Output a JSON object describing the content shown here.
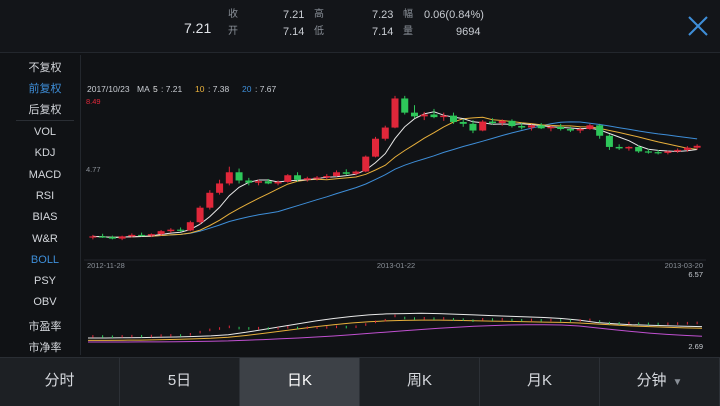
{
  "quote": {
    "price": "7.21",
    "close_label": "收",
    "close": "7.21",
    "open_label": "开",
    "open": "7.14",
    "high_label": "高",
    "high": "7.23",
    "low_label": "低",
    "low": "7.14",
    "change_label": "幅",
    "change": "0.06(0.84%)",
    "volume_label": "量",
    "volume": "9694"
  },
  "close_icon": "close-x-icon",
  "sidebar": {
    "adjust": [
      {
        "label": "不复权",
        "active": false
      },
      {
        "label": "前复权",
        "active": true
      },
      {
        "label": "后复权",
        "active": false
      }
    ],
    "indicators": [
      {
        "label": "VOL",
        "active": false
      },
      {
        "label": "KDJ",
        "active": false
      },
      {
        "label": "MACD",
        "active": false
      },
      {
        "label": "RSI",
        "active": false
      },
      {
        "label": "BIAS",
        "active": false
      },
      {
        "label": "W&R",
        "active": false
      },
      {
        "label": "BOLL",
        "active": true
      },
      {
        "label": "PSY",
        "active": false
      },
      {
        "label": "OBV",
        "active": false
      },
      {
        "label": "市盈率",
        "active": false
      },
      {
        "label": "市净率",
        "active": false
      }
    ]
  },
  "tabs": [
    {
      "label": "分时",
      "active": false
    },
    {
      "label": "5日",
      "active": false
    },
    {
      "label": "日K",
      "active": true
    },
    {
      "label": "周K",
      "active": false
    },
    {
      "label": "月K",
      "active": false
    },
    {
      "label": "分钟",
      "active": false,
      "dropdown": true
    }
  ],
  "colors": {
    "up": "#e0273a",
    "down": "#2ec75a",
    "ma5": "#e8e8e8",
    "ma10": "#e8b03c",
    "ma20": "#3e8ed8"
  },
  "chart_data": [
    {
      "type": "candlestick",
      "title": "2017/10/23",
      "ma_label": "MA",
      "legend": [
        {
          "label": "5",
          "value": "7.21",
          "color": "#e8e8e8"
        },
        {
          "label": "10",
          "value": "7.38",
          "color": "#e8b03c"
        },
        {
          "label": "20",
          "value": "7.67",
          "color": "#3e8ed8"
        }
      ],
      "ylim": [
        4.2,
        8.6
      ],
      "y_ticks": [
        "8.49",
        "4.77"
      ],
      "x_ticks": [
        "2012-11-28",
        "2013-01-22",
        "2013-03-20"
      ],
      "ohlc": [
        [
          4.75,
          4.82,
          4.7,
          4.78
        ],
        [
          4.78,
          4.85,
          4.74,
          4.76
        ],
        [
          4.76,
          4.8,
          4.7,
          4.72
        ],
        [
          4.72,
          4.8,
          4.68,
          4.78
        ],
        [
          4.78,
          4.86,
          4.75,
          4.82
        ],
        [
          4.82,
          4.88,
          4.78,
          4.8
        ],
        [
          4.8,
          4.86,
          4.76,
          4.84
        ],
        [
          4.84,
          4.95,
          4.8,
          4.92
        ],
        [
          4.92,
          5.0,
          4.88,
          4.96
        ],
        [
          4.96,
          5.02,
          4.9,
          4.94
        ],
        [
          4.94,
          5.2,
          4.92,
          5.16
        ],
        [
          5.16,
          5.6,
          5.1,
          5.55
        ],
        [
          5.55,
          6.02,
          5.5,
          5.95
        ],
        [
          5.95,
          6.3,
          5.9,
          6.2
        ],
        [
          6.2,
          6.65,
          6.15,
          6.5
        ],
        [
          6.5,
          6.6,
          6.2,
          6.28
        ],
        [
          6.28,
          6.35,
          6.15,
          6.22
        ],
        [
          6.22,
          6.3,
          6.15,
          6.26
        ],
        [
          6.26,
          6.32,
          6.18,
          6.2
        ],
        [
          6.2,
          6.28,
          6.15,
          6.24
        ],
        [
          6.24,
          6.45,
          6.22,
          6.42
        ],
        [
          6.42,
          6.5,
          6.25,
          6.3
        ],
        [
          6.3,
          6.38,
          6.25,
          6.34
        ],
        [
          6.34,
          6.4,
          6.28,
          6.36
        ],
        [
          6.36,
          6.45,
          6.32,
          6.4
        ],
        [
          6.4,
          6.55,
          6.38,
          6.5
        ],
        [
          6.5,
          6.58,
          6.42,
          6.46
        ],
        [
          6.46,
          6.55,
          6.42,
          6.52
        ],
        [
          6.52,
          6.95,
          6.5,
          6.92
        ],
        [
          6.92,
          7.45,
          6.9,
          7.4
        ],
        [
          7.4,
          7.75,
          7.35,
          7.7
        ],
        [
          7.7,
          8.55,
          7.68,
          8.48
        ],
        [
          8.48,
          8.55,
          8.05,
          8.1
        ],
        [
          8.1,
          8.3,
          7.95,
          8.0
        ],
        [
          8.0,
          8.12,
          7.9,
          8.05
        ],
        [
          8.05,
          8.2,
          7.95,
          7.98
        ],
        [
          7.98,
          8.1,
          7.88,
          8.02
        ],
        [
          8.02,
          8.1,
          7.8,
          7.85
        ],
        [
          7.85,
          7.92,
          7.72,
          7.8
        ],
        [
          7.8,
          7.9,
          7.55,
          7.62
        ],
        [
          7.62,
          7.9,
          7.6,
          7.86
        ],
        [
          7.86,
          7.95,
          7.78,
          7.82
        ],
        [
          7.82,
          7.92,
          7.75,
          7.88
        ],
        [
          7.88,
          7.92,
          7.7,
          7.74
        ],
        [
          7.74,
          7.82,
          7.65,
          7.7
        ],
        [
          7.7,
          7.78,
          7.62,
          7.76
        ],
        [
          7.76,
          7.82,
          7.66,
          7.68
        ],
        [
          7.68,
          7.75,
          7.6,
          7.72
        ],
        [
          7.72,
          7.8,
          7.62,
          7.66
        ],
        [
          7.66,
          7.72,
          7.58,
          7.62
        ],
        [
          7.62,
          7.7,
          7.55,
          7.66
        ],
        [
          7.66,
          7.8,
          7.64,
          7.76
        ],
        [
          7.76,
          7.8,
          7.4,
          7.48
        ],
        [
          7.48,
          7.52,
          7.1,
          7.18
        ],
        [
          7.18,
          7.25,
          7.1,
          7.14
        ],
        [
          7.14,
          7.2,
          7.08,
          7.18
        ],
        [
          7.18,
          7.22,
          7.02,
          7.06
        ],
        [
          7.06,
          7.12,
          7.0,
          7.04
        ],
        [
          7.04,
          7.1,
          6.98,
          7.02
        ],
        [
          7.02,
          7.08,
          6.98,
          7.06
        ],
        [
          7.06,
          7.14,
          7.02,
          7.1
        ],
        [
          7.1,
          7.2,
          7.05,
          7.16
        ],
        [
          7.16,
          7.25,
          7.1,
          7.21
        ]
      ]
    },
    {
      "type": "line",
      "title": "BOLL",
      "ylim": [
        2.69,
        6.57
      ],
      "y_ticks": [
        "6.57",
        "2.69"
      ],
      "series": [
        {
          "color": "#e8e8e8",
          "values": [
            3.0,
            3.0,
            3.01,
            3.02,
            3.04,
            3.06,
            3.09,
            3.13,
            3.2,
            3.35,
            3.52,
            3.7,
            3.88,
            4.05,
            4.2,
            4.32,
            4.42,
            4.48,
            4.5,
            4.52,
            4.5,
            4.46,
            4.42,
            4.38,
            4.34,
            4.3,
            4.26,
            4.2,
            4.1,
            3.95,
            3.88,
            3.82,
            3.78,
            3.75,
            3.72,
            3.7
          ]
        },
        {
          "color": "#e8b03c",
          "values": [
            2.85,
            2.85,
            2.86,
            2.87,
            2.89,
            2.91,
            2.94,
            2.98,
            3.04,
            3.15,
            3.28,
            3.42,
            3.56,
            3.7,
            3.82,
            3.92,
            4.0,
            4.05,
            4.08,
            4.1,
            4.1,
            4.08,
            4.06,
            4.04,
            4.02,
            4.0,
            3.98,
            3.96,
            3.92,
            3.86,
            3.8,
            3.74,
            3.7,
            3.66,
            3.62,
            3.6
          ]
        },
        {
          "color": "#c050d0",
          "values": [
            2.75,
            2.75,
            2.75,
            2.76,
            2.76,
            2.77,
            2.78,
            2.8,
            2.82,
            2.86,
            2.9,
            2.95,
            3.0,
            3.06,
            3.12,
            3.2,
            3.28,
            3.36,
            3.44,
            3.52,
            3.6,
            3.66,
            3.72,
            3.76,
            3.8,
            3.82,
            3.82,
            3.8,
            3.74,
            3.62,
            3.5,
            3.4,
            3.3,
            3.22,
            3.16,
            3.1
          ]
        }
      ]
    }
  ]
}
